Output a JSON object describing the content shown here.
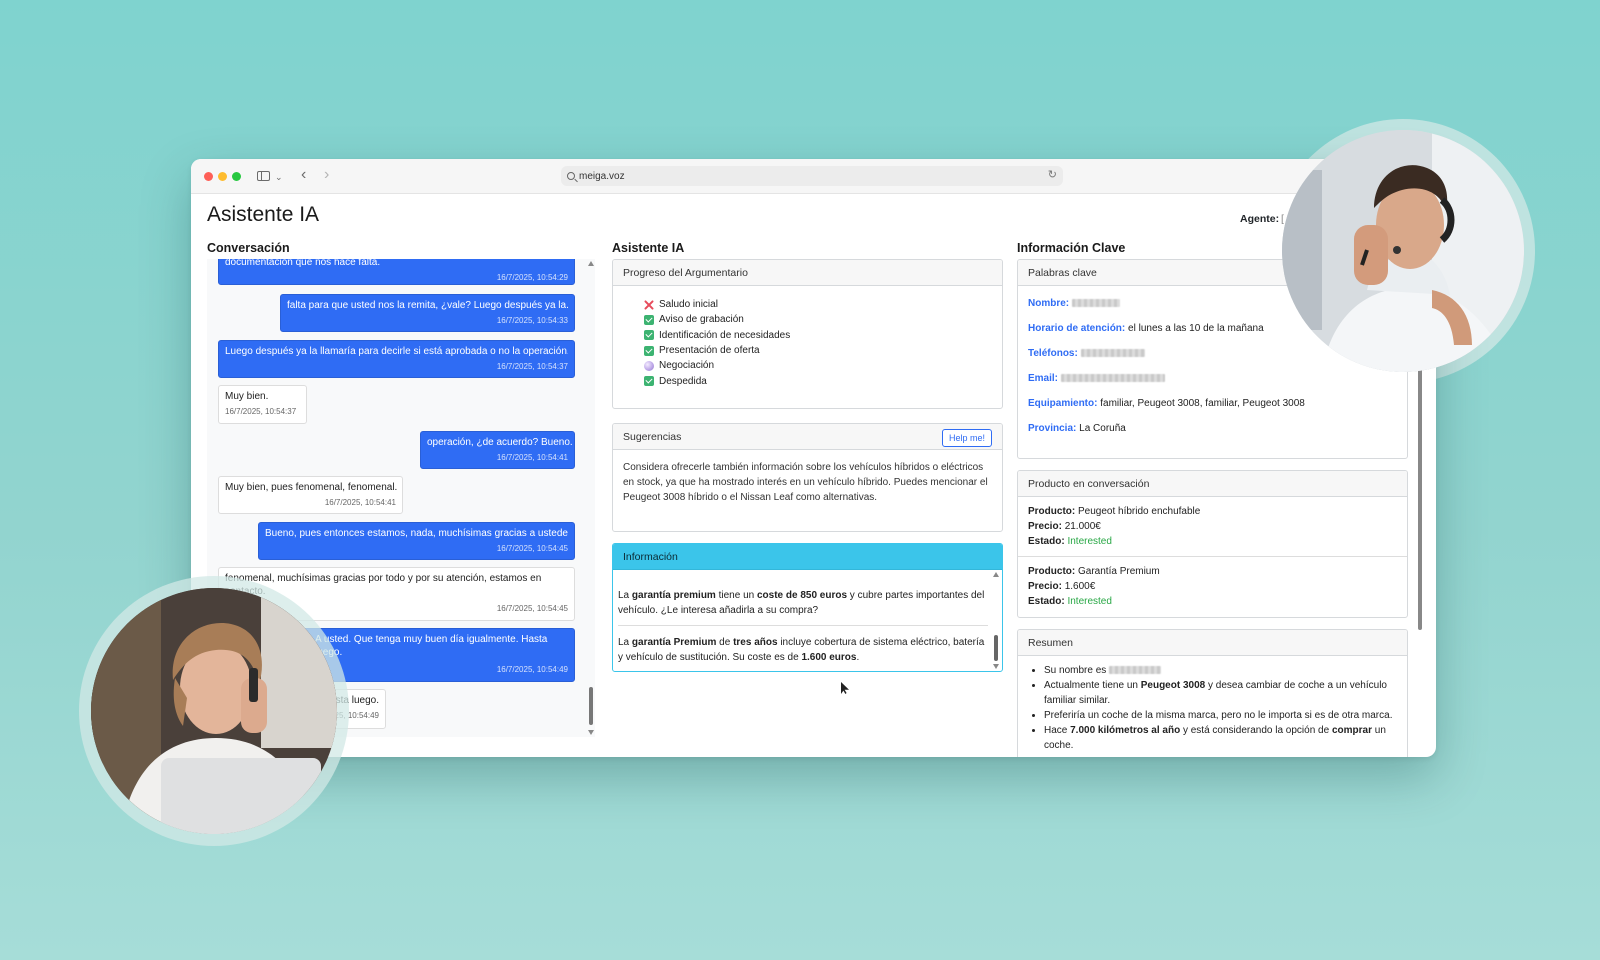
{
  "browser": {
    "url": "meiga.voz"
  },
  "header": {
    "title": "Asistente IA",
    "agent_label": "Agente:",
    "agent_value": "["
  },
  "columns": {
    "conversation_title": "Conversación",
    "assistant_title": "Asistente IA",
    "key_info_title": "Información Clave"
  },
  "conversation": {
    "messages": [
      {
        "role": "agent",
        "text": "documentación que nos hace falta.",
        "time": "16/7/2025, 10:54:29"
      },
      {
        "role": "agent",
        "text": "falta para que usted nos la remita, ¿vale? Luego después ya la...",
        "time": "16/7/2025, 10:54:33"
      },
      {
        "role": "agent",
        "text": "Luego después ya la llamaría para decirle si está aprobada o no la operación.",
        "time": "16/7/2025, 10:54:37"
      },
      {
        "role": "client",
        "text": "Muy bien.",
        "time": "16/7/2025, 10:54:37"
      },
      {
        "role": "agent",
        "text": "operación, ¿de acuerdo? Bueno.",
        "time": "16/7/2025, 10:54:41"
      },
      {
        "role": "client",
        "text": "Muy bien, pues fenomenal, fenomenal.",
        "time": "16/7/2025, 10:54:41"
      },
      {
        "role": "agent",
        "text": "Bueno, pues entonces estamos, nada, muchísimas gracias a ustedes.",
        "time": "16/7/2025, 10:54:45"
      },
      {
        "role": "client",
        "text": "fenomenal, muchísimas gracias por todo y por su atención, estamos en contacto.",
        "time": "16/7/2025, 10:54:45"
      },
      {
        "role": "agent",
        "text": "A usted. Que tenga muy buen día igualmente. Hasta luego.",
        "time": "16/7/2025, 10:54:49"
      },
      {
        "role": "client",
        "text": "Hasta luego.",
        "time": "16/7/2025, 10:54:49"
      }
    ]
  },
  "progress": {
    "title": "Progreso del Argumentario",
    "items": [
      {
        "label": "Saludo inicial",
        "state": "fail"
      },
      {
        "label": "Aviso de grabación",
        "state": "done"
      },
      {
        "label": "Identificación de necesidades",
        "state": "done"
      },
      {
        "label": "Presentación de oferta",
        "state": "done"
      },
      {
        "label": "Negociación",
        "state": "pending"
      },
      {
        "label": "Despedida",
        "state": "done"
      }
    ]
  },
  "suggestions": {
    "title": "Sugerencias",
    "help_button": "Help me!",
    "text": "Considera ofrecerle también información sobre los vehículos híbridos o eléctricos en stock, ya que ha mostrado interés en un vehículo híbrido. Puedes mencionar el Peugeot 3008 híbrido o el Nissan Leaf como alternativas."
  },
  "information": {
    "title": "Información",
    "entry1": {
      "p1": "La ",
      "b1": "garantía premium",
      "p2": " tiene un ",
      "b2": "coste de 850 euros",
      "p3": " y cubre partes importantes del vehículo. ¿Le interesa añadirla a su compra?"
    },
    "entry2": {
      "p1": "La ",
      "b1": "garantía Premium",
      "p2": " de ",
      "b2": "tres años",
      "p3": " incluye cobertura de sistema eléctrico, batería y vehículo de sustitución. Su coste es de ",
      "b3": "1.600 euros",
      "p4": "."
    }
  },
  "keywords": {
    "title": "Palabras clave",
    "nombre_key": "Nombre:",
    "horario_key": "Horario de atención:",
    "horario_val": "el lunes a las 10 de la mañana",
    "telefonos_key": "Teléfonos:",
    "email_key": "Email:",
    "equipamiento_key": "Equipamiento:",
    "equipamiento_val": "familiar, Peugeot 3008, familiar, Peugeot 3008",
    "provincia_key": "Provincia:",
    "provincia_val": "La Coruña"
  },
  "products": {
    "title": "Producto en conversación",
    "producto_label": "Producto:",
    "precio_label": "Precio:",
    "estado_label": "Estado:",
    "items": [
      {
        "name": "Peugeot híbrido enchufable",
        "price": "21.000€",
        "status": "Interested"
      },
      {
        "name": "Garantía Premium",
        "price": "1.600€",
        "status": "Interested"
      }
    ]
  },
  "summary": {
    "title": "Resumen",
    "item1": "Su nombre es",
    "item2_a": "Actualmente tiene un ",
    "item2_b": "Peugeot 3008",
    "item2_c": " y desea cambiar de coche a un vehículo familiar similar.",
    "item3": "Preferiría un coche de la misma marca, pero no le importa si es de otra marca.",
    "item4_a": "Hace ",
    "item4_b": "7.000 kilómetros al año",
    "item4_c": " y está considerando la opción de ",
    "item4_d": "comprar",
    "item4_e": " un coche."
  },
  "colors": {
    "agent_bubble": "#2f6cf4",
    "info_header": "#3bc5ea",
    "keyword": "#2f6cf4",
    "status": "#28a745"
  }
}
